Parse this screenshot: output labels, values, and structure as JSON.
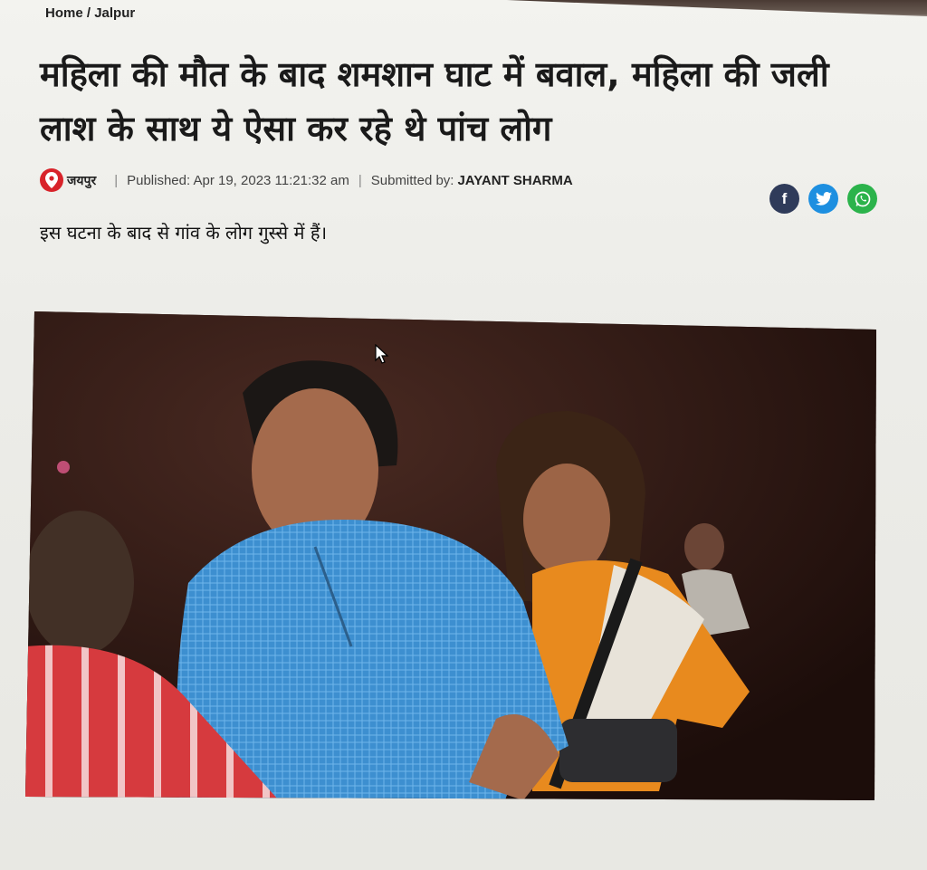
{
  "breadcrumb": {
    "home": "Home",
    "separator": "/",
    "section": "Jalpur"
  },
  "article": {
    "headline": "महिला की मौत के बाद शमशान घाट में बवाल, महिला की जली लाश के साथ ये ऐसा कर रहे थे पांच लोग",
    "location": "जयपुर",
    "published": "Published: Apr 19, 2023 11:21:32 am",
    "submitted_label": "Submitted by:",
    "author": "JAYANT SHARMA",
    "summary": "इस घटना के बाद से गांव के लोग गुस्से में हैं।"
  },
  "share": {
    "facebook": "f",
    "twitter_icon": "twitter-icon",
    "whatsapp_icon": "whatsapp-icon"
  },
  "colors": {
    "pin": "#d8232a",
    "facebook": "#2f3b5a",
    "twitter": "#1d8fe0",
    "whatsapp": "#2bb34b"
  }
}
